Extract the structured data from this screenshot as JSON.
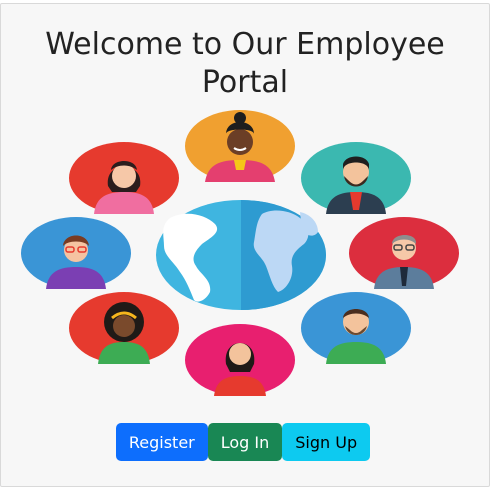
{
  "header": {
    "title": "Welcome to Our Employee Portal"
  },
  "actions": {
    "register_label": "Register",
    "login_label": "Log In",
    "signup_label": "Sign Up"
  },
  "colors": {
    "register": "#0d6efd",
    "login": "#198754",
    "signup": "#0dcaf0",
    "globe_water": "#43b8e0",
    "globe_land": "#ffffff"
  },
  "illustration": {
    "icons": [
      "globe-icon",
      "employee-avatar-icon"
    ]
  }
}
